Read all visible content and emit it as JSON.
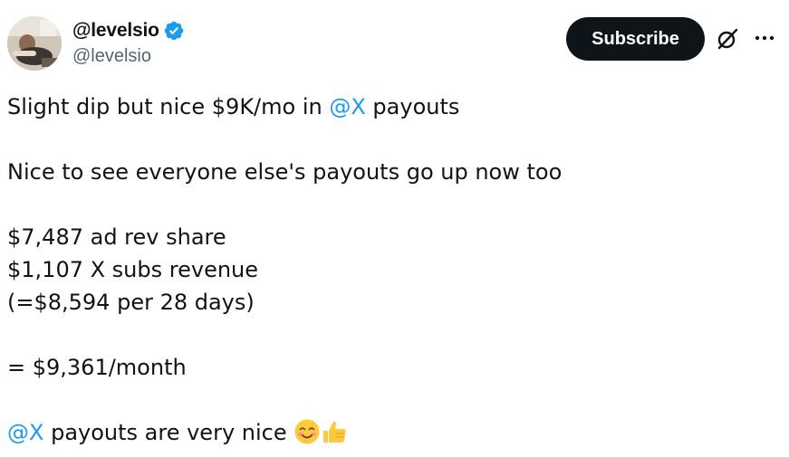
{
  "author": {
    "display_name": "@levelsio",
    "handle": "@levelsio",
    "verified": true,
    "verified_color": "#1d9bf0"
  },
  "actions": {
    "subscribe_label": "Subscribe",
    "grok_icon": "grok-icon",
    "more_icon": "more-icon"
  },
  "tweet": {
    "line1_before": "Slight dip but nice $9K/mo in ",
    "line1_mention": "@X",
    "line1_after": " payouts",
    "line2": "Nice to see everyone else's payouts go up now too",
    "line3": "$7,487 ad rev share",
    "line4": "$1,107 X subs revenue",
    "line5": "(=$8,594 per 28 days)",
    "line6": "= $9,361/month",
    "line7_mention": "@X",
    "line7_after": " payouts are very nice ",
    "emojis": [
      "smiling-face-emoji",
      "thumbs-up-emoji"
    ]
  },
  "colors": {
    "text": "#0f1419",
    "secondary": "#536471",
    "link": "#1d9bf0",
    "button_bg": "#0f1419",
    "button_text": "#ffffff"
  }
}
